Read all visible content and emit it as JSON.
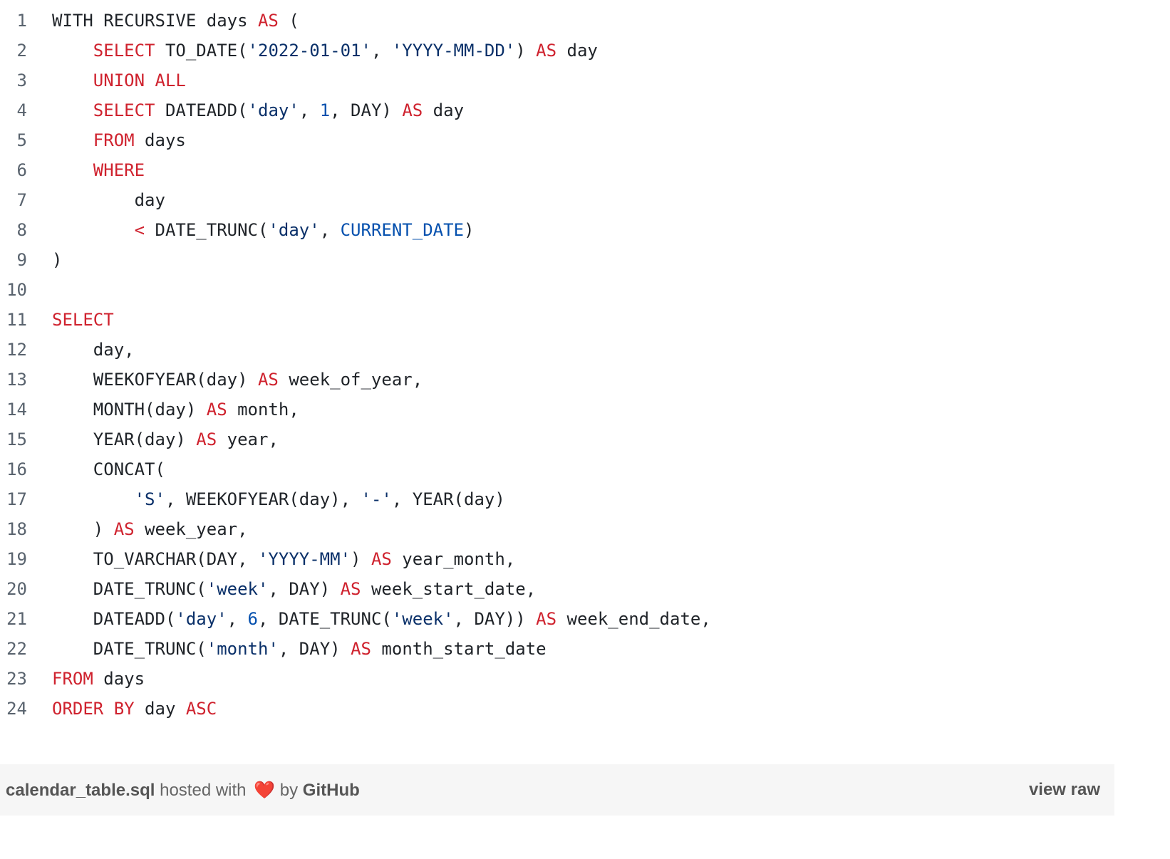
{
  "file": {
    "name": "calendar_table.sql"
  },
  "footer": {
    "filename": "calendar_table.sql",
    "hosted_with": "hosted with",
    "heart_icon": "heart-icon",
    "by": "by",
    "host": "GitHub",
    "view_raw": "view raw"
  },
  "colors": {
    "keyword": "#cf222e",
    "string": "#0a3069",
    "number": "#0550ae",
    "text": "#1f2328",
    "line_number": "#59636e",
    "footer_bg": "#f6f6f6"
  },
  "lines": [
    {
      "n": "1",
      "tokens": [
        {
          "t": "WITH RECURSIVE days ",
          "c": ""
        },
        {
          "t": "AS",
          "c": "kw"
        },
        {
          "t": " (",
          "c": ""
        }
      ]
    },
    {
      "n": "2",
      "tokens": [
        {
          "t": "    ",
          "c": ""
        },
        {
          "t": "SELECT",
          "c": "kw"
        },
        {
          "t": " TO_DATE(",
          "c": ""
        },
        {
          "t": "'2022-01-01'",
          "c": "str"
        },
        {
          "t": ", ",
          "c": ""
        },
        {
          "t": "'YYYY-MM-DD'",
          "c": "str"
        },
        {
          "t": ") ",
          "c": ""
        },
        {
          "t": "AS",
          "c": "kw"
        },
        {
          "t": " day",
          "c": ""
        }
      ]
    },
    {
      "n": "3",
      "tokens": [
        {
          "t": "    ",
          "c": ""
        },
        {
          "t": "UNION ALL",
          "c": "kw"
        }
      ]
    },
    {
      "n": "4",
      "tokens": [
        {
          "t": "    ",
          "c": ""
        },
        {
          "t": "SELECT",
          "c": "kw"
        },
        {
          "t": " DATEADD(",
          "c": ""
        },
        {
          "t": "'day'",
          "c": "str"
        },
        {
          "t": ", ",
          "c": ""
        },
        {
          "t": "1",
          "c": "num"
        },
        {
          "t": ", DAY) ",
          "c": ""
        },
        {
          "t": "AS",
          "c": "kw"
        },
        {
          "t": " day",
          "c": ""
        }
      ]
    },
    {
      "n": "5",
      "tokens": [
        {
          "t": "    ",
          "c": ""
        },
        {
          "t": "FROM",
          "c": "kw"
        },
        {
          "t": " days",
          "c": ""
        }
      ]
    },
    {
      "n": "6",
      "tokens": [
        {
          "t": "    ",
          "c": ""
        },
        {
          "t": "WHERE",
          "c": "kw"
        }
      ]
    },
    {
      "n": "7",
      "tokens": [
        {
          "t": "        day",
          "c": ""
        }
      ]
    },
    {
      "n": "8",
      "tokens": [
        {
          "t": "        ",
          "c": ""
        },
        {
          "t": "<",
          "c": "kw"
        },
        {
          "t": " DATE_TRUNC(",
          "c": ""
        },
        {
          "t": "'day'",
          "c": "str"
        },
        {
          "t": ", ",
          "c": ""
        },
        {
          "t": "CURRENT_DATE",
          "c": "const"
        },
        {
          "t": ")",
          "c": ""
        }
      ]
    },
    {
      "n": "9",
      "tokens": [
        {
          "t": ")",
          "c": ""
        }
      ]
    },
    {
      "n": "10",
      "tokens": []
    },
    {
      "n": "11",
      "tokens": [
        {
          "t": "SELECT",
          "c": "kw"
        }
      ]
    },
    {
      "n": "12",
      "tokens": [
        {
          "t": "    day,",
          "c": ""
        }
      ]
    },
    {
      "n": "13",
      "tokens": [
        {
          "t": "    WEEKOFYEAR(day) ",
          "c": ""
        },
        {
          "t": "AS",
          "c": "kw"
        },
        {
          "t": " week_of_year,",
          "c": ""
        }
      ]
    },
    {
      "n": "14",
      "tokens": [
        {
          "t": "    MONTH(day) ",
          "c": ""
        },
        {
          "t": "AS",
          "c": "kw"
        },
        {
          "t": " month,",
          "c": ""
        }
      ]
    },
    {
      "n": "15",
      "tokens": [
        {
          "t": "    YEAR(day) ",
          "c": ""
        },
        {
          "t": "AS",
          "c": "kw"
        },
        {
          "t": " year,",
          "c": ""
        }
      ]
    },
    {
      "n": "16",
      "tokens": [
        {
          "t": "    CONCAT(",
          "c": ""
        }
      ]
    },
    {
      "n": "17",
      "tokens": [
        {
          "t": "        ",
          "c": ""
        },
        {
          "t": "'S'",
          "c": "str"
        },
        {
          "t": ", WEEKOFYEAR(day), ",
          "c": ""
        },
        {
          "t": "'-'",
          "c": "str"
        },
        {
          "t": ", YEAR(day)",
          "c": ""
        }
      ]
    },
    {
      "n": "18",
      "tokens": [
        {
          "t": "    ) ",
          "c": ""
        },
        {
          "t": "AS",
          "c": "kw"
        },
        {
          "t": " week_year,",
          "c": ""
        }
      ]
    },
    {
      "n": "19",
      "tokens": [
        {
          "t": "    TO_VARCHAR(DAY, ",
          "c": ""
        },
        {
          "t": "'YYYY-MM'",
          "c": "str"
        },
        {
          "t": ") ",
          "c": ""
        },
        {
          "t": "AS",
          "c": "kw"
        },
        {
          "t": " year_month,",
          "c": ""
        }
      ]
    },
    {
      "n": "20",
      "tokens": [
        {
          "t": "    DATE_TRUNC(",
          "c": ""
        },
        {
          "t": "'week'",
          "c": "str"
        },
        {
          "t": ", DAY) ",
          "c": ""
        },
        {
          "t": "AS",
          "c": "kw"
        },
        {
          "t": " week_start_date,",
          "c": ""
        }
      ]
    },
    {
      "n": "21",
      "tokens": [
        {
          "t": "    DATEADD(",
          "c": ""
        },
        {
          "t": "'day'",
          "c": "str"
        },
        {
          "t": ", ",
          "c": ""
        },
        {
          "t": "6",
          "c": "num"
        },
        {
          "t": ", DATE_TRUNC(",
          "c": ""
        },
        {
          "t": "'week'",
          "c": "str"
        },
        {
          "t": ", DAY)) ",
          "c": ""
        },
        {
          "t": "AS",
          "c": "kw"
        },
        {
          "t": " week_end_date,",
          "c": ""
        }
      ]
    },
    {
      "n": "22",
      "tokens": [
        {
          "t": "    DATE_TRUNC(",
          "c": ""
        },
        {
          "t": "'month'",
          "c": "str"
        },
        {
          "t": ", DAY) ",
          "c": ""
        },
        {
          "t": "AS",
          "c": "kw"
        },
        {
          "t": " month_start_date",
          "c": ""
        }
      ]
    },
    {
      "n": "23",
      "tokens": [
        {
          "t": "FROM",
          "c": "kw"
        },
        {
          "t": " days",
          "c": ""
        }
      ]
    },
    {
      "n": "24",
      "tokens": [
        {
          "t": "ORDER BY",
          "c": "kw"
        },
        {
          "t": " day ",
          "c": ""
        },
        {
          "t": "ASC",
          "c": "kw"
        }
      ]
    }
  ]
}
